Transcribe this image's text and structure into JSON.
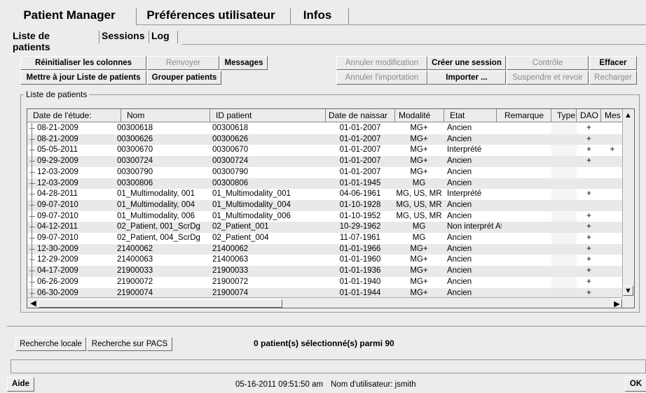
{
  "main_tabs": [
    {
      "label": "Patient Manager"
    },
    {
      "label": "Préférences utilisateur"
    },
    {
      "label": "Infos"
    }
  ],
  "sub_tabs": [
    {
      "label": "Liste de patients"
    },
    {
      "label": "Sessions"
    },
    {
      "label": "Log"
    }
  ],
  "toolbar": {
    "reset_columns": "Réinitialiser les colonnes",
    "renvoyer": "Renvoyer",
    "messages": "Messages",
    "update_list": "Mettre à jour Liste de patients",
    "group_patients": "Grouper patients",
    "cancel_modification": "Annuler modification",
    "create_session": "Créer une session",
    "control": "Contrôle",
    "erase": "Effacer",
    "cancel_import": "Annuler l'importation",
    "import": "Importer ...",
    "suspend_review": "Suspendre et revoir",
    "reload": "Recharger"
  },
  "group_title": "Liste de patients",
  "table": {
    "columns": [
      "Date de l'étude:",
      "Nom",
      "ID patient",
      "Date de naissar",
      "Modalité",
      "Etat",
      "Remarque",
      "Type",
      "DAO",
      "Mes"
    ],
    "rows": [
      [
        "08-21-2009",
        "00300618",
        "00300618",
        "01-01-2007",
        "MG+",
        "Ancien",
        "",
        "",
        "+",
        ""
      ],
      [
        "08-21-2009",
        "00300626",
        "00300626",
        "01-01-2007",
        "MG+",
        "Ancien",
        "",
        "",
        "+",
        ""
      ],
      [
        "05-05-2011",
        "00300670",
        "00300670",
        "01-01-2007",
        "MG+",
        "Interprété",
        "",
        "",
        "+",
        "+"
      ],
      [
        "09-29-2009",
        "00300724",
        "00300724",
        "01-01-2007",
        "MG+",
        "Ancien",
        "",
        "",
        "+",
        ""
      ],
      [
        "12-03-2009",
        "00300790",
        "00300790",
        "01-01-2007",
        "MG+",
        "Ancien",
        "",
        "",
        "",
        ""
      ],
      [
        "12-03-2009",
        "00300806",
        "00300806",
        "01-01-1945",
        "MG",
        "Ancien",
        "",
        "",
        "",
        ""
      ],
      [
        "04-28-2011",
        "01_Multimodality, 001",
        "01_Multimodality_001",
        "04-06-1961",
        "MG, US, MR",
        "Interprété",
        "",
        "",
        "+",
        ""
      ],
      [
        "09-07-2010",
        "01_Multimodality, 004",
        "01_Multimodality_004",
        "01-10-1928",
        "MG, US, MR",
        "Ancien",
        "",
        "",
        "",
        ""
      ],
      [
        "09-07-2010",
        "01_Multimodality, 006",
        "01_Multimodality_006",
        "01-10-1952",
        "MG, US, MR",
        "Ancien",
        "",
        "",
        "+",
        ""
      ],
      [
        "04-12-2011",
        "02_Patient, 001_ScrDg",
        "02_Patient_001",
        "10-29-1962",
        "MG",
        "Non interprét Att.",
        "",
        "",
        "+",
        ""
      ],
      [
        "09-07-2010",
        "02_Patient, 004_ScrDg",
        "02_Patient_004",
        "11-07-1961",
        "MG",
        "Ancien",
        "",
        "",
        "+",
        ""
      ],
      [
        "12-30-2009",
        "21400062",
        "21400062",
        "01-01-1966",
        "MG+",
        "Ancien",
        "",
        "",
        "+",
        ""
      ],
      [
        "12-29-2009",
        "21400063",
        "21400063",
        "01-01-1960",
        "MG+",
        "Ancien",
        "",
        "",
        "+",
        ""
      ],
      [
        "04-17-2009",
        "21900033",
        "21900033",
        "01-01-1936",
        "MG+",
        "Ancien",
        "",
        "",
        "+",
        ""
      ],
      [
        "06-26-2009",
        "21900072",
        "21900072",
        "01-01-1940",
        "MG+",
        "Ancien",
        "",
        "",
        "+",
        ""
      ],
      [
        "06-30-2009",
        "21900074",
        "21900074",
        "01-01-1944",
        "MG+",
        "Ancien",
        "",
        "",
        "+",
        ""
      ]
    ]
  },
  "bottom": {
    "local_search": "Recherche locale",
    "pacs_search": "Recherche sur PACS",
    "selection_status": "0 patient(s) sélectionné(s) parmi 90"
  },
  "footer": {
    "help": "Aide",
    "datetime": "05-16-2011  09:51:50 am",
    "user_label": "Nom d'utilisateur:  jsmith",
    "ok": "OK"
  }
}
